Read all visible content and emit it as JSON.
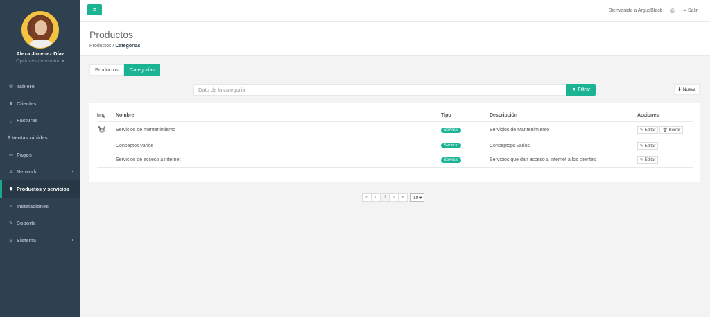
{
  "user": {
    "name": "Alexa Jimenez Díaz",
    "options": "Opciones de usuario ▾"
  },
  "nav": [
    {
      "label": "Tablero",
      "icon": "dashboard-icon"
    },
    {
      "label": "Clientes",
      "icon": "users-icon"
    },
    {
      "label": "Facturas",
      "icon": "file-icon"
    },
    {
      "label": "$ Ventas rápidas",
      "icon": "dollar-icon"
    },
    {
      "label": "Pagos",
      "icon": "money-icon"
    },
    {
      "label": "Network",
      "icon": "network-icon"
    },
    {
      "label": "Productos y servicios",
      "icon": "tag-icon"
    },
    {
      "label": "Instalaciones",
      "icon": "rocket-icon"
    },
    {
      "label": "Soporte",
      "icon": "wrench-icon"
    },
    {
      "label": "Sistema",
      "icon": "cogs-icon"
    }
  ],
  "topbar": {
    "menu_icon": "≡",
    "welcome": "Bienvenido a ArgusBlack",
    "logout": "Salir"
  },
  "heading": {
    "title": "Productos",
    "crumb_parent": "Productos",
    "crumb_sep": "/",
    "crumb_current": "Categorías"
  },
  "tabs": [
    "Productos",
    "Categorías"
  ],
  "search": {
    "placeholder": "Dato de la categoría",
    "filter_label": "Filtrar",
    "new_label": "Nueva"
  },
  "table": {
    "headers": {
      "img": "Img",
      "name": "Nombre",
      "type": "Tipo",
      "desc": "Descripción",
      "actions": "Acciones"
    },
    "rows": [
      {
        "name": "Servicios de mantenimiento",
        "type": "Servicio",
        "desc": "Servicios de Mantenimiento"
      },
      {
        "name": "Conceptos varios",
        "type": "Servicio",
        "desc": "Conceptops varios"
      },
      {
        "name": "Servicios de acceso a internet",
        "type": "Servicio",
        "desc": "Servicios que dan acceso a internet a los clientes"
      }
    ],
    "edit_label": "Editar",
    "delete_label": "Borrar"
  },
  "pager": {
    "first": "«",
    "prev": "‹",
    "page": "1",
    "next": "›",
    "last": "»",
    "per_page": "10 ▾"
  },
  "colors": {
    "accent": "#1ab394",
    "sidebar": "#2f4050"
  }
}
